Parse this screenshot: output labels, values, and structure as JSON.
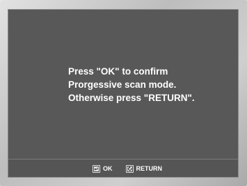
{
  "dialog": {
    "lines": [
      "Press \"OK\" to confirm",
      "Prorgessive scan mode.",
      "Otherwise press \"RETURN\"."
    ]
  },
  "footer": {
    "ok": {
      "label": "OK",
      "icon": "enter-icon"
    },
    "return": {
      "label": "RETURN",
      "icon": "return-icon"
    }
  },
  "colors": {
    "screen_bg": "#585858",
    "frame": "#c8c8c8",
    "text": "#ffffff"
  }
}
